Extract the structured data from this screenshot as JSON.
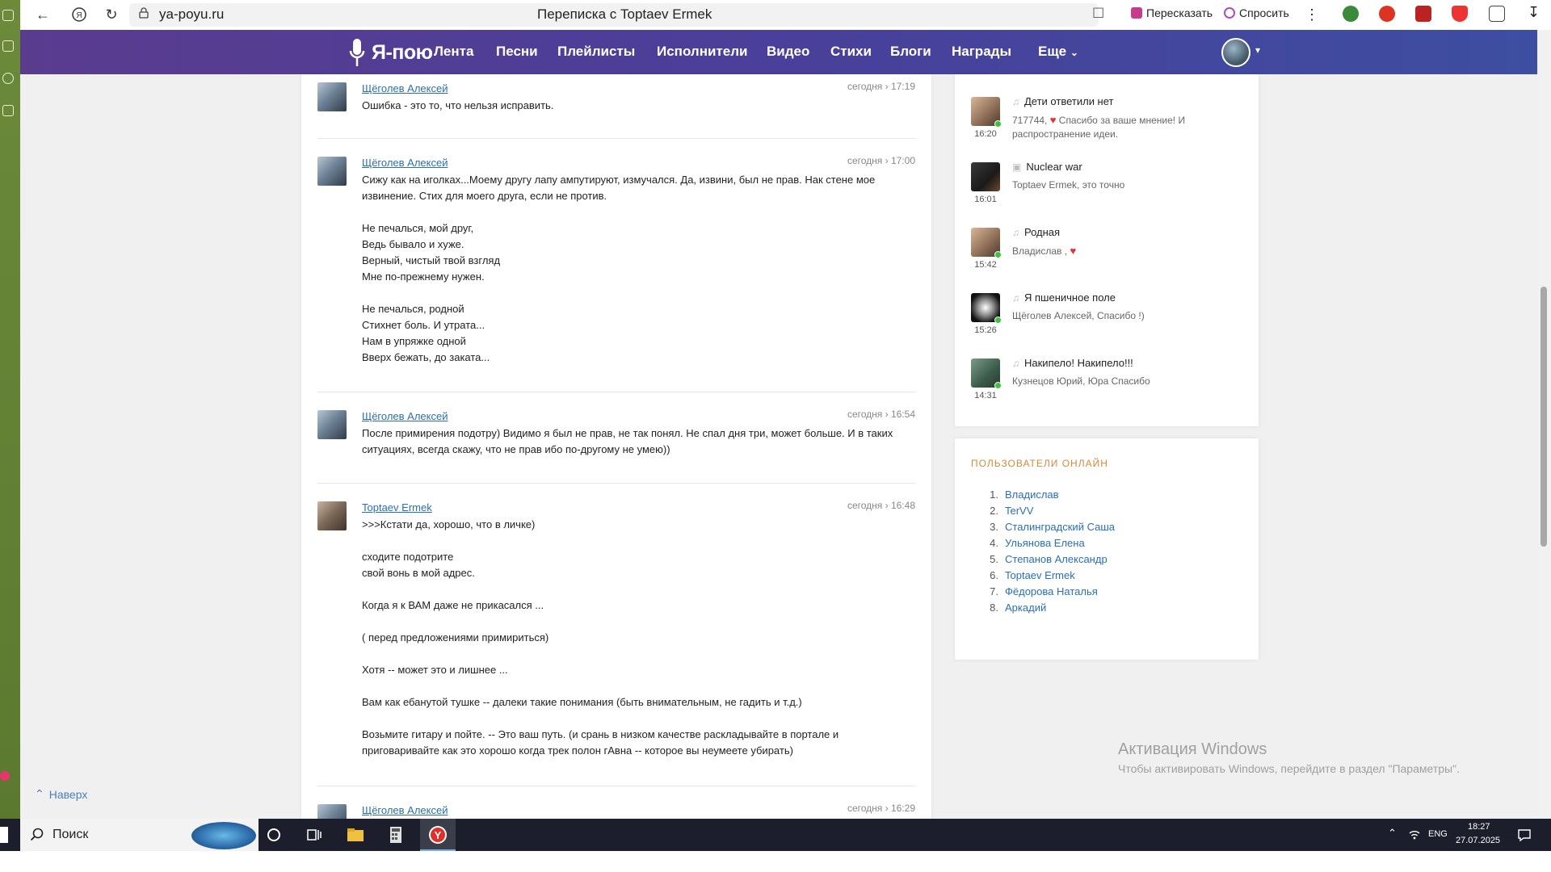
{
  "browser": {
    "url": "ya-poyu.ru",
    "page_title": "Переписка с Toptaev Ermek",
    "retell_label": "Пересказать",
    "ask_label": "Спросить"
  },
  "nav": {
    "logo_text": "Я-пою",
    "items": [
      "Лента",
      "Песни",
      "Плейлисты",
      "Исполнители",
      "Видео",
      "Стихи",
      "Блоги",
      "Награды",
      "Еще"
    ]
  },
  "messages": [
    {
      "author": "Щёголев Алексей",
      "time": "сегодня › 17:19",
      "lines": [
        "Ошибка - это то, что нельзя исправить."
      ]
    },
    {
      "author": "Щёголев Алексей",
      "time": "сегодня › 17:00",
      "lines": [
        "Сижу как на иголках...Моему другу лапу ампутируют, измучался. Да, извини, был не прав. Нак стене мое",
        "извинение. Стих для моего друга, если не против.",
        "",
        "Не печалься, мой друг,",
        "Ведь бывало и хуже.",
        "Верный, чистый твой взгляд",
        "Мне по-прежнему нужен.",
        "",
        "Не печалься, родной",
        "Стихнет боль. И утрата...",
        "Нам в упряжке одной",
        "Вверх бежать, до заката..."
      ]
    },
    {
      "author": "Щёголев Алексей",
      "time": "сегодня › 16:54",
      "lines": [
        "После примирения подотру) Видимо я был не прав, не так понял. Не спал дня три, может больше. И в таких",
        "ситуациях, всегда скажу, что не прав ибо по-другому не умею))"
      ]
    },
    {
      "author": "Toptaev Ermek",
      "time": "сегодня › 16:48",
      "lines": [
        ">>>Кстати да, хорошо, что в личке)",
        "",
        "сходите подотрите",
        "свой вонь в мой адрес.",
        "",
        "Когда я к ВАМ даже не прикасался ...",
        "",
        "( перед предложениями примириться)",
        "",
        "Хотя -- может это и лишнее ...",
        "",
        "Вам как ебанутой тушке -- далеки такие понимания (быть внимательным, не гадить и т.д.)",
        "",
        "Возьмите гитару и пойте. -- Это ваш путь. (и срань в низком качестве раскладывайте в портале и",
        "приговаривайте как это хорошо когда трек полон гАвна -- которое вы неумеете убирать)"
      ]
    },
    {
      "author": "Щёголев Алексей",
      "time": "сегодня › 16:29",
      "lines": []
    }
  ],
  "activity": [
    {
      "title": "Дети ответили нет",
      "type": "music",
      "text": "717744, ♥ Спасибо за ваше мнение! И распространение идеи.",
      "time": "16:20",
      "online": true
    },
    {
      "title": "Nuclear war",
      "type": "video",
      "text": "Toptaev Ermek, это точно",
      "time": "16:01",
      "online": false
    },
    {
      "title": "Родная",
      "type": "music",
      "text": "Владислав , ♥",
      "time": "15:42",
      "online": true
    },
    {
      "title": "Я пшеничное поле",
      "type": "music",
      "text": "Щёголев Алексей, Спасибо !)",
      "time": "15:26",
      "online": true
    },
    {
      "title": "Накипело! Накипело!!!",
      "type": "music",
      "text": "Кузнецов Юрий, Юра Спасибо",
      "time": "14:31",
      "online": true
    }
  ],
  "online_users": {
    "title": "ПОЛЬЗОВАТЕЛИ ОНЛАЙН",
    "users": [
      "Владислав",
      "TerVV",
      "Сталинградский Саша",
      "Ульянова Елена",
      "Степанов Александр",
      "Toptaev Ermek",
      "Фёдорова Наталья",
      "Аркадий"
    ]
  },
  "to_top_label": "Наверх",
  "windows_activation": {
    "title": "Активация Windows",
    "subtitle": "Чтобы активировать Windows, перейдите в раздел \"Параметры\"."
  },
  "taskbar": {
    "search_label": "Поиск",
    "lang": "ENG",
    "time": "18:27",
    "date": "27.07.2025"
  }
}
